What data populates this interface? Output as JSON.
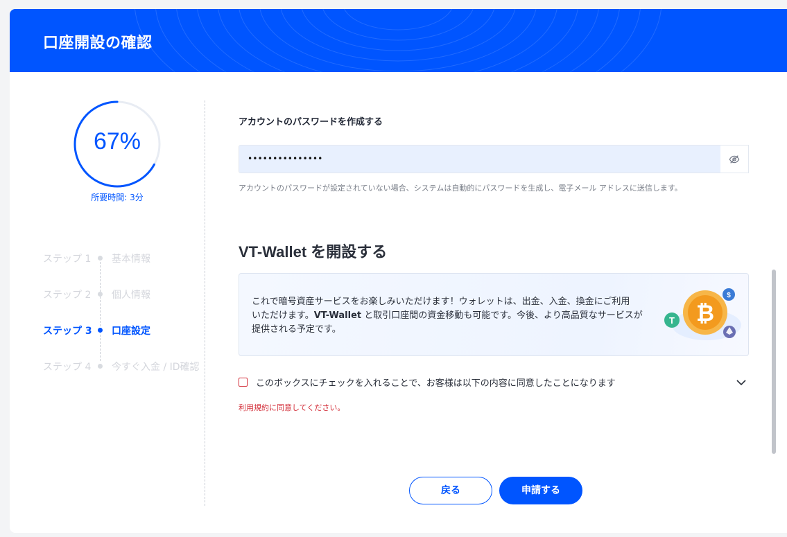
{
  "header": {
    "title": "口座開設の確認"
  },
  "progress": {
    "percent_label": "67%",
    "fraction": 0.67,
    "time_label": "所要時間: 3分"
  },
  "steps": [
    {
      "num": "ステップ 1",
      "name": "基本情報",
      "state": "done"
    },
    {
      "num": "ステップ 2",
      "name": "個人情報",
      "state": "done"
    },
    {
      "num": "ステップ 3",
      "name": "口座設定",
      "state": "active"
    },
    {
      "num": "ステップ 4",
      "name": "今すぐ入金 / ID確認",
      "state": "pending"
    }
  ],
  "password": {
    "label": "アカウントのパスワードを作成する",
    "value": "•••••••••••••••",
    "help": "アカウントのパスワードが設定されていない場合、システムは自動的にパスワードを生成し、電子メール アドレスに送信します。",
    "toggle_icon": "eye-off-icon"
  },
  "wallet": {
    "title": "VT-Wallet を開設する",
    "desc_1": "これで暗号資産サービスをお楽しみいただけます！ウォレットは、出金、入金、換金にご利用",
    "desc_2_pre": "いただけます。",
    "desc_2_bold": "VT-Wallet",
    "desc_2_post": " と取引口座間の資金移動も可能です。今後、より高品質なサービスが",
    "desc_3": "提供される予定です。"
  },
  "agreement": {
    "label": "このボックスにチェックを入れることで、お客様は以下の内容に同意したことになります",
    "checked": false,
    "error": "利用規約に同意してください。"
  },
  "buttons": {
    "back": "戻る",
    "submit": "申請する"
  },
  "colors": {
    "primary": "#0055ff",
    "error": "#d32f3a",
    "inactive": "#d4d6dc"
  }
}
